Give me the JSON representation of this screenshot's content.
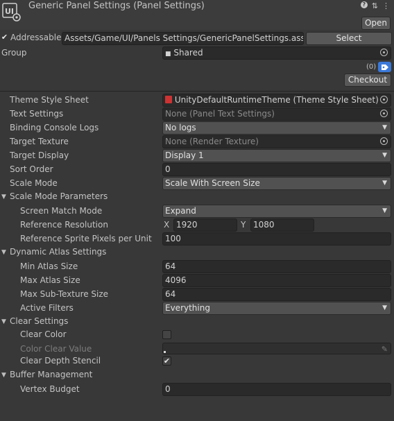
{
  "header": {
    "title": "Generic Panel Settings (Panel Settings)",
    "open_label": "Open",
    "select_label": "Select",
    "addressable_label": "Addressable",
    "addressable_checked": true,
    "address_path": "Assets/Game/UI/Panels Settings/GenericPanelSettings.asset",
    "group_label": "Group",
    "group_value": "Shared",
    "labels_count": "(0)",
    "checkout_label": "Checkout"
  },
  "fields": {
    "theme_style_sheet": {
      "label": "Theme Style Sheet",
      "value": "UnityDefaultRuntimeTheme (Theme Style Sheet)"
    },
    "text_settings": {
      "label": "Text Settings",
      "value": "None (Panel Text Settings)"
    },
    "binding_console_logs": {
      "label": "Binding Console Logs",
      "value": "No logs"
    },
    "target_texture": {
      "label": "Target Texture",
      "value": "None (Render Texture)"
    },
    "target_display": {
      "label": "Target Display",
      "value": "Display 1"
    },
    "sort_order": {
      "label": "Sort Order",
      "value": "0"
    },
    "scale_mode": {
      "label": "Scale Mode",
      "value": "Scale With Screen Size"
    }
  },
  "scale_params": {
    "header": "Scale Mode Parameters",
    "screen_match_mode": {
      "label": "Screen Match Mode",
      "value": "Expand"
    },
    "reference_resolution": {
      "label": "Reference Resolution",
      "x_label": "X",
      "x": "1920",
      "y_label": "Y",
      "y": "1080"
    },
    "ref_sprite_ppu": {
      "label": "Reference Sprite Pixels per Unit",
      "value": "100"
    }
  },
  "atlas": {
    "header": "Dynamic Atlas Settings",
    "min_atlas": {
      "label": "Min Atlas Size",
      "value": "64"
    },
    "max_atlas": {
      "label": "Max Atlas Size",
      "value": "4096"
    },
    "max_sub": {
      "label": "Max Sub-Texture Size",
      "value": "64"
    },
    "active_filters": {
      "label": "Active Filters",
      "value": "Everything"
    }
  },
  "clear": {
    "header": "Clear Settings",
    "clear_color": {
      "label": "Clear Color",
      "checked": false
    },
    "color_clear_value": {
      "label": "Color Clear Value"
    },
    "clear_depth_stencil": {
      "label": "Clear Depth Stencil",
      "checked": true
    }
  },
  "buffer": {
    "header": "Buffer Management",
    "vertex_budget": {
      "label": "Vertex Budget",
      "value": "0"
    }
  },
  "colors": {
    "background": "#383838",
    "field": "#2a2a2a",
    "dropdown": "#515151",
    "accent_blue": "#3a79d9"
  }
}
